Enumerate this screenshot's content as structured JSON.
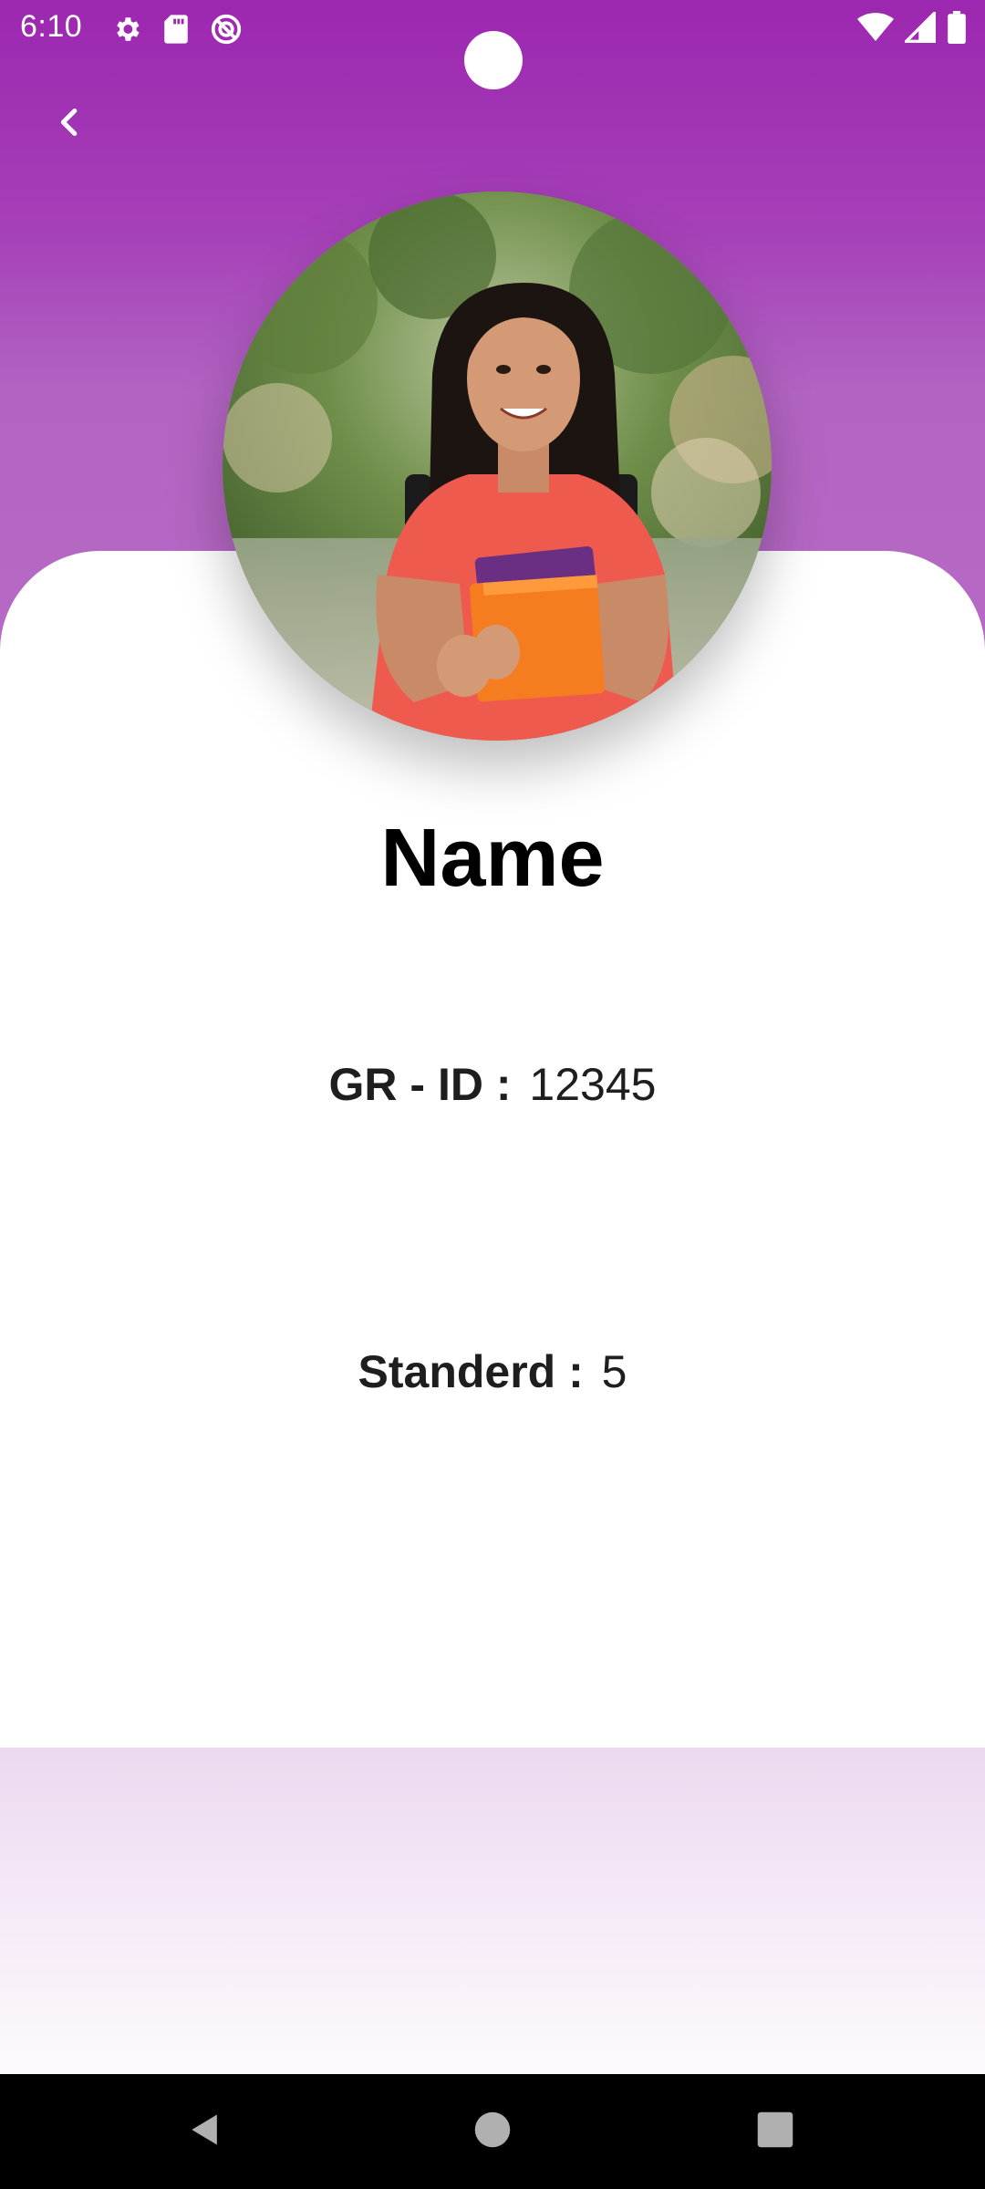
{
  "status_bar": {
    "time": "6:10",
    "left_icons": [
      "gear-icon",
      "sd-card-icon",
      "no-disturb-icon"
    ],
    "right_icons": [
      "wifi-icon",
      "signal-icon",
      "battery-icon"
    ]
  },
  "header": {
    "back_icon": "chevron-left-icon",
    "background_color": "#9c27b0"
  },
  "profile": {
    "name": "Name",
    "gr_id_label": "GR - ID :",
    "gr_id_value": "12345",
    "standard_label": "Standerd :",
    "standard_value": "5"
  },
  "nav_bar": {
    "icons": [
      "back-triangle-icon",
      "home-circle-icon",
      "recents-square-icon"
    ]
  }
}
